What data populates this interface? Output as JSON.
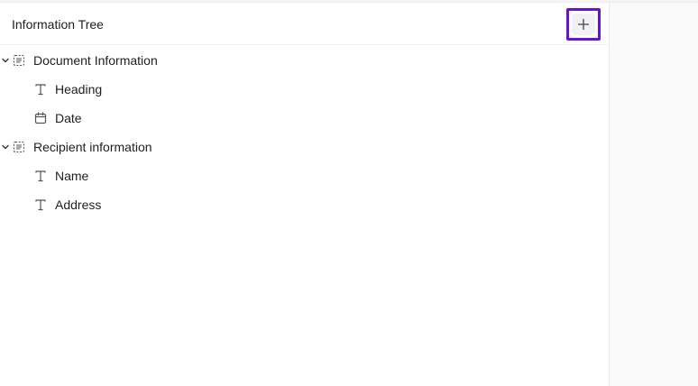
{
  "header": {
    "title": "Information Tree",
    "add_button_icon": "plus-icon"
  },
  "tree": [
    {
      "label": "Document Information",
      "icon": "group-fields-icon",
      "expanded": true,
      "children": [
        {
          "label": "Heading",
          "icon": "text-type-icon"
        },
        {
          "label": "Date",
          "icon": "calendar-icon"
        }
      ]
    },
    {
      "label": "Recipient information",
      "icon": "group-fields-icon",
      "expanded": true,
      "children": [
        {
          "label": "Name",
          "icon": "text-type-icon"
        },
        {
          "label": "Address",
          "icon": "text-type-icon"
        }
      ]
    }
  ],
  "colors": {
    "highlight_border": "#6a11cf",
    "text": "#1f1f1f",
    "icon": "#555555",
    "right_pane_bg": "#fafafa"
  }
}
